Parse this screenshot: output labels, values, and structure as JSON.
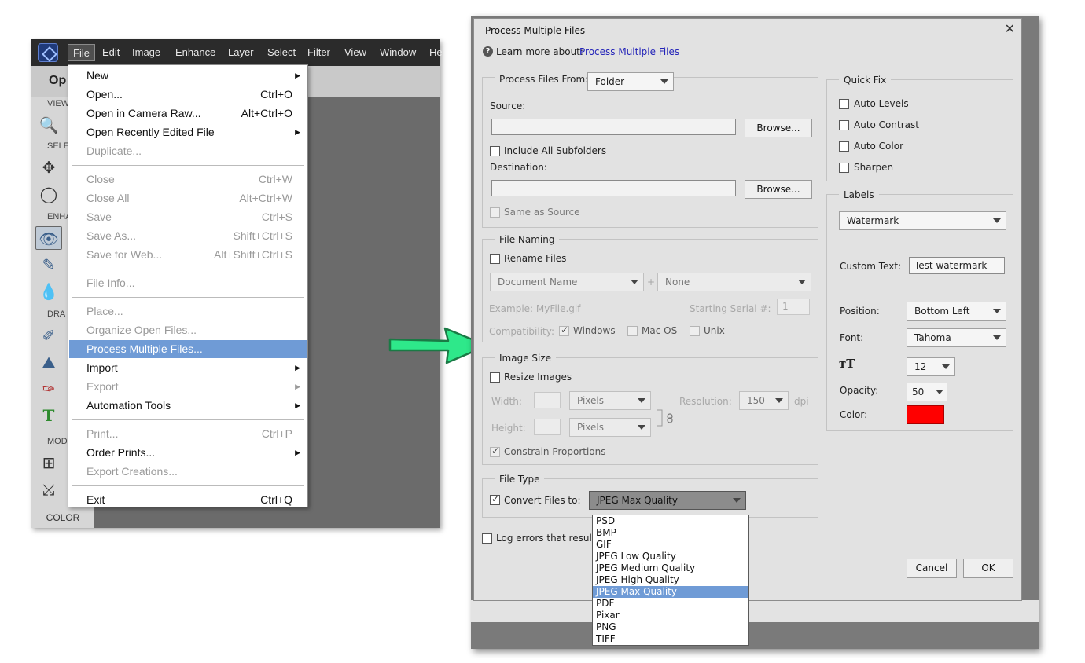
{
  "app": {
    "menubar": [
      "File",
      "Edit",
      "Image",
      "Enhance",
      "Layer",
      "Select",
      "Filter",
      "View",
      "Window",
      "He"
    ],
    "optbar_text": "Op",
    "tool_sections": [
      "VIEW",
      "SELE",
      "ENHA",
      "DRA",
      "MOD"
    ],
    "color_label": "COLOR"
  },
  "file_menu": [
    {
      "label": "New",
      "shortcut": "",
      "submenu": true,
      "disabled": false
    },
    {
      "label": "Open...",
      "shortcut": "Ctrl+O",
      "disabled": false
    },
    {
      "label": "Open in Camera Raw...",
      "shortcut": "Alt+Ctrl+O",
      "disabled": false
    },
    {
      "label": "Open Recently Edited File",
      "shortcut": "",
      "submenu": true,
      "disabled": false
    },
    {
      "label": "Duplicate...",
      "shortcut": "",
      "disabled": true
    },
    {
      "label": "Close",
      "shortcut": "Ctrl+W",
      "disabled": true
    },
    {
      "label": "Close All",
      "shortcut": "Alt+Ctrl+W",
      "disabled": true
    },
    {
      "label": "Save",
      "shortcut": "Ctrl+S",
      "disabled": true
    },
    {
      "label": "Save As...",
      "shortcut": "Shift+Ctrl+S",
      "disabled": true
    },
    {
      "label": "Save for Web...",
      "shortcut": "Alt+Shift+Ctrl+S",
      "disabled": true
    },
    {
      "label": "File Info...",
      "shortcut": "",
      "disabled": true
    },
    {
      "label": "Place...",
      "shortcut": "",
      "disabled": true
    },
    {
      "label": "Organize Open Files...",
      "shortcut": "",
      "disabled": true
    },
    {
      "label": "Process Multiple Files...",
      "shortcut": "",
      "disabled": false,
      "highlighted": true
    },
    {
      "label": "Import",
      "shortcut": "",
      "submenu": true,
      "disabled": false
    },
    {
      "label": "Export",
      "shortcut": "",
      "submenu": true,
      "disabled": true
    },
    {
      "label": "Automation Tools",
      "shortcut": "",
      "submenu": true,
      "disabled": false
    },
    {
      "label": "Print...",
      "shortcut": "Ctrl+P",
      "disabled": true
    },
    {
      "label": "Order Prints...",
      "shortcut": "",
      "submenu": true,
      "disabled": false
    },
    {
      "label": "Export Creations...",
      "shortcut": "",
      "disabled": true
    },
    {
      "label": "Exit",
      "shortcut": "Ctrl+Q",
      "disabled": false
    }
  ],
  "dialog": {
    "title": "Process Multiple Files",
    "close_glyph": "✕",
    "learn_prefix": "Learn more about:",
    "learn_link": "Process Multiple Files",
    "process_from_label": "Process Files From:",
    "process_from_value": "Folder",
    "source_label": "Source:",
    "browse_label": "Browse...",
    "include_subfolders": "Include All Subfolders",
    "destination_label": "Destination:",
    "same_as_source": "Same as Source",
    "file_naming": {
      "title": "File Naming",
      "rename_files": "Rename Files",
      "name_combo": "Document Name",
      "plus": "+",
      "second_combo": "None",
      "example": "Example: MyFile.gif",
      "starting_serial_label": "Starting Serial #:",
      "starting_serial_value": "1",
      "compatibility_label": "Compatibility:",
      "windows": "Windows",
      "mac_os": "Mac OS",
      "unix": "Unix"
    },
    "image_size": {
      "title": "Image Size",
      "resize_images": "Resize Images",
      "width_label": "Width:",
      "height_label": "Height:",
      "unit": "Pixels",
      "resolution_label": "Resolution:",
      "resolution_value": "150",
      "dpi": "dpi",
      "constrain": "Constrain Proportions"
    },
    "file_type": {
      "title": "File Type",
      "convert_label": "Convert Files to:",
      "selected": "JPEG Max Quality",
      "options": [
        "PSD",
        "BMP",
        "GIF",
        "JPEG Low Quality",
        "JPEG Medium Quality",
        "JPEG High Quality",
        "JPEG Max Quality",
        "PDF",
        "Pixar",
        "PNG",
        "TIFF"
      ]
    },
    "log_errors": "Log errors that result",
    "quick_fix": {
      "title": "Quick Fix",
      "items": [
        "Auto Levels",
        "Auto Contrast",
        "Auto Color",
        "Sharpen"
      ]
    },
    "labels": {
      "title": "Labels",
      "type_value": "Watermark",
      "custom_text_label": "Custom Text:",
      "custom_text_value": "Test watermark",
      "position_label": "Position:",
      "position_value": "Bottom Left",
      "font_label": "Font:",
      "font_value": "Tahoma",
      "size_value": "12",
      "opacity_label": "Opacity:",
      "opacity_value": "50",
      "color_label": "Color:",
      "color_hex": "#ff0000"
    },
    "cancel": "Cancel",
    "ok": "OK"
  }
}
